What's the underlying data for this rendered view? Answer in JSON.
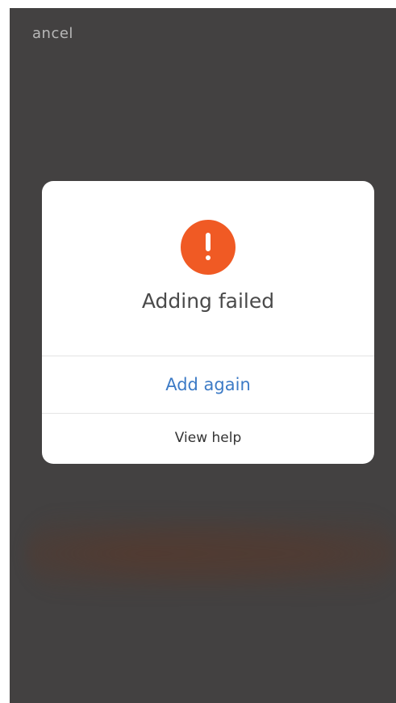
{
  "header": {
    "cancel_label": "ancel"
  },
  "dialog": {
    "icon": "alert-exclamation-icon",
    "title": "Adding failed",
    "primary_action": "Add again",
    "secondary_action": "View help"
  },
  "colors": {
    "overlay": "#434141",
    "alert": "#f05a24",
    "link": "#3d7bc6"
  }
}
